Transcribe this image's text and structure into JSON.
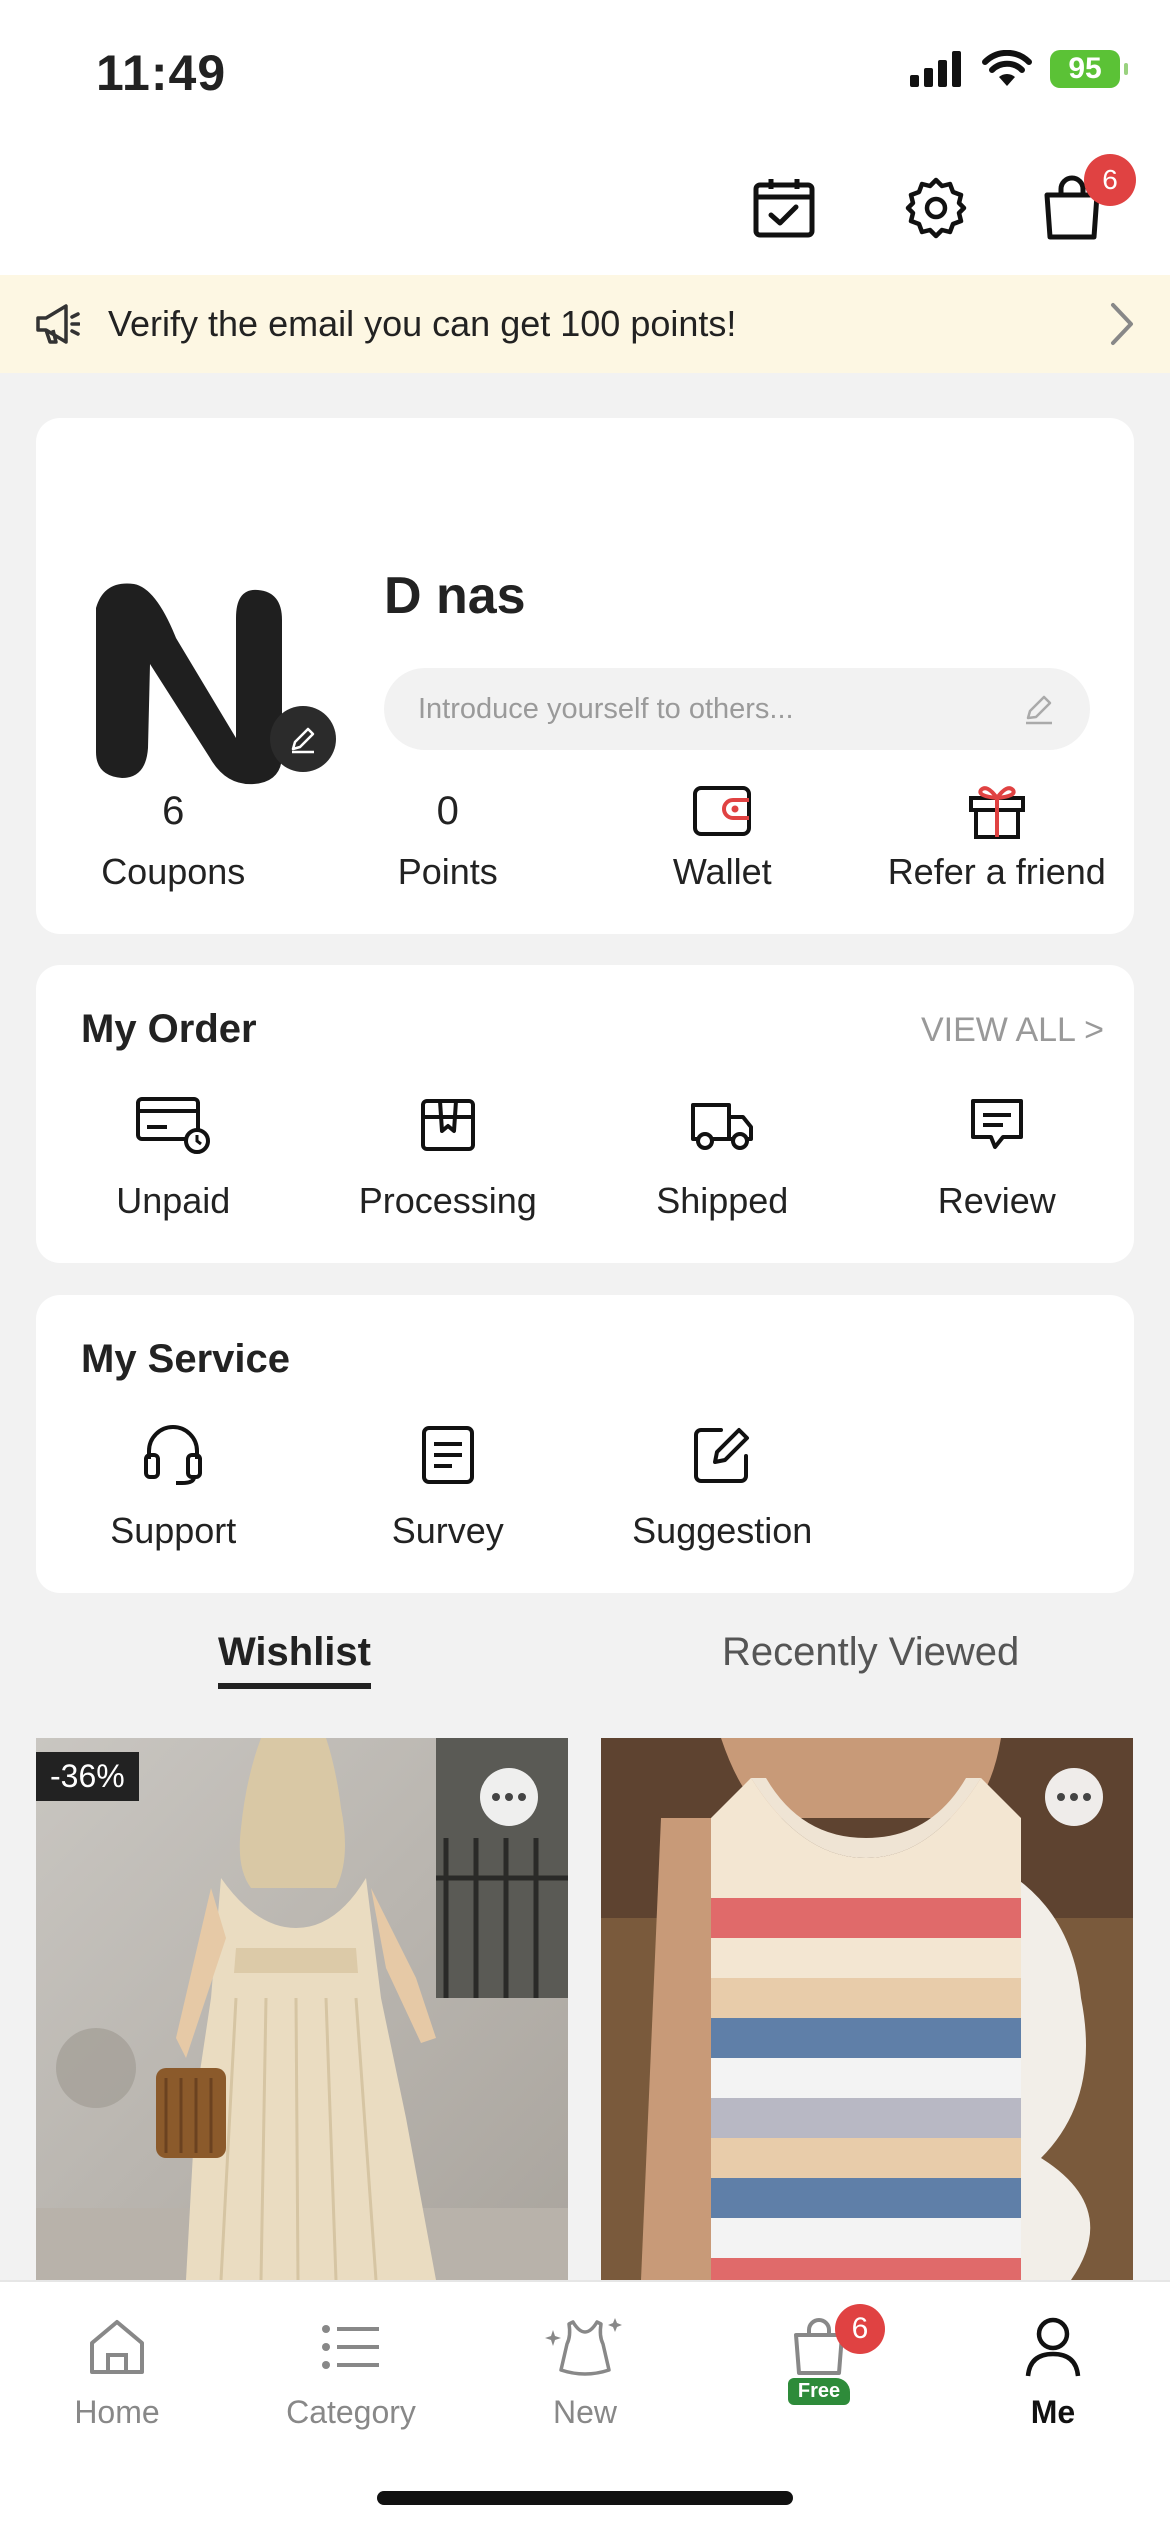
{
  "status_bar": {
    "time": "11:49",
    "battery": "95"
  },
  "header": {
    "cart_badge": "6"
  },
  "banner": {
    "text": "Verify the email you can get 100 points!"
  },
  "profile": {
    "name": "D nas",
    "bio_placeholder": "Introduce yourself to others...",
    "stats": [
      {
        "value": "6",
        "label": "Coupons"
      },
      {
        "value": "0",
        "label": "Points"
      },
      {
        "label": "Wallet",
        "icon": "wallet-icon"
      },
      {
        "label": "Refer a friend",
        "icon": "gift-icon"
      }
    ]
  },
  "my_order": {
    "title": "My Order",
    "view_all": "VIEW ALL >",
    "items": [
      {
        "label": "Unpaid",
        "icon": "card-clock-icon"
      },
      {
        "label": "Processing",
        "icon": "box-icon"
      },
      {
        "label": "Shipped",
        "icon": "truck-icon"
      },
      {
        "label": "Review",
        "icon": "chat-icon"
      }
    ]
  },
  "my_service": {
    "title": "My Service",
    "items": [
      {
        "label": "Support",
        "icon": "headset-icon"
      },
      {
        "label": "Survey",
        "icon": "document-icon"
      },
      {
        "label": "Suggestion",
        "icon": "edit-icon"
      }
    ]
  },
  "tabs": {
    "wishlist": "Wishlist",
    "recently_viewed": "Recently Viewed"
  },
  "products": [
    {
      "discount": "-36%"
    },
    {
      "discount": ""
    }
  ],
  "tabbar": {
    "items": [
      {
        "label": "Home",
        "icon": "home-icon"
      },
      {
        "label": "Category",
        "icon": "list-icon"
      },
      {
        "label": "New",
        "icon": "sparkle-dress-icon"
      },
      {
        "label": "",
        "icon": "cart-icon",
        "badge": "6",
        "tag": "Free"
      },
      {
        "label": "Me",
        "icon": "person-icon",
        "active": true
      }
    ]
  },
  "colors": {
    "accent_red": "#e04242",
    "banner_bg": "#fdf7e3",
    "free_green": "#2e8b3a"
  }
}
